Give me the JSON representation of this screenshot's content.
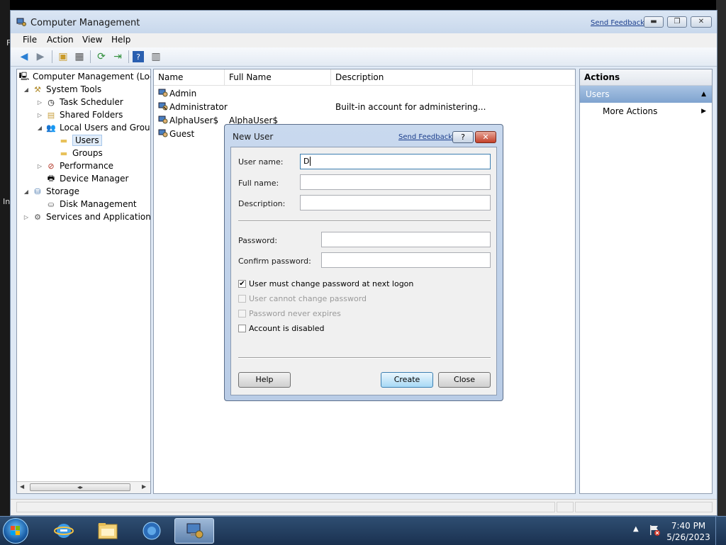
{
  "window": {
    "title": "Computer Management",
    "send_feedback": "Send Feedback"
  },
  "menu": [
    "File",
    "Action",
    "View",
    "Help"
  ],
  "desktop_fragments": [
    "F",
    "In"
  ],
  "tree": [
    {
      "label": "Computer Management (Local",
      "level": 0,
      "expander": "",
      "icon": "computer-management-icon"
    },
    {
      "label": "System Tools",
      "level": 1,
      "expander": "◢",
      "icon": "system-tools-icon"
    },
    {
      "label": "Task Scheduler",
      "level": 2,
      "expander": "▷",
      "icon": "clock-icon"
    },
    {
      "label": "Shared Folders",
      "level": 2,
      "expander": "▷",
      "icon": "shared-folder-icon"
    },
    {
      "label": "Local Users and Groups",
      "level": 2,
      "expander": "◢",
      "icon": "users-groups-icon"
    },
    {
      "label": "Users",
      "level": 3,
      "expander": "",
      "icon": "folder-icon",
      "selected": true
    },
    {
      "label": "Groups",
      "level": 3,
      "expander": "",
      "icon": "folder-icon"
    },
    {
      "label": "Performance",
      "level": 2,
      "expander": "▷",
      "icon": "performance-icon"
    },
    {
      "label": "Device Manager",
      "level": 2,
      "expander": "",
      "icon": "device-manager-icon"
    },
    {
      "label": "Storage",
      "level": 1,
      "expander": "◢",
      "icon": "storage-icon"
    },
    {
      "label": "Disk Management",
      "level": 2,
      "expander": "",
      "icon": "disk-icon"
    },
    {
      "label": "Services and Applications",
      "level": 1,
      "expander": "▷",
      "icon": "services-icon"
    }
  ],
  "list": {
    "columns": [
      "Name",
      "Full Name",
      "Description"
    ],
    "rows": [
      {
        "name": "Admin",
        "full_name": "",
        "description": ""
      },
      {
        "name": "Administrator",
        "full_name": "",
        "description": "Built-in account for administering..."
      },
      {
        "name": "AlphaUser$",
        "full_name": "AlphaUser$",
        "description": ""
      },
      {
        "name": "Guest",
        "full_name": "",
        "description": ""
      }
    ]
  },
  "actions": {
    "header": "Actions",
    "section": "Users",
    "items": [
      "More Actions"
    ]
  },
  "dialog": {
    "title": "New User",
    "send_feedback": "Send Feedback",
    "help_glyph": "?",
    "close_glyph": "✕",
    "user_name_label": "User name:",
    "user_name_value": "D",
    "full_name_label": "Full name:",
    "full_name_value": "",
    "description_label": "Description:",
    "description_value": "",
    "password_label": "Password:",
    "confirm_label": "Confirm password:",
    "checkboxes": [
      {
        "label": "User must change password at next logon",
        "checked": true,
        "disabled": false
      },
      {
        "label": "User cannot change password",
        "checked": false,
        "disabled": true
      },
      {
        "label": "Password never expires",
        "checked": false,
        "disabled": true
      },
      {
        "label": "Account is disabled",
        "checked": false,
        "disabled": false
      }
    ],
    "help_button": "Help",
    "create_button": "Create",
    "close_button": "Close"
  },
  "taskbar": {
    "time": "7:40 PM",
    "date": "5/26/2023",
    "apps": [
      "internet-explorer-icon",
      "file-explorer-icon",
      "media-player-icon",
      "computer-management-icon"
    ]
  }
}
